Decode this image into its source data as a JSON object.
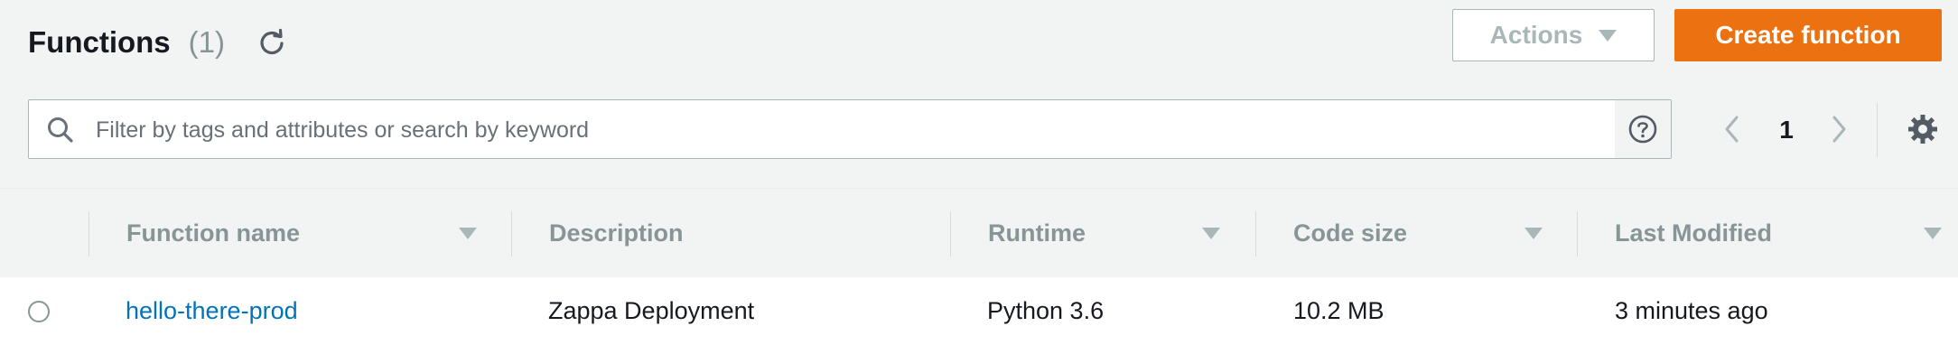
{
  "header": {
    "title": "Functions",
    "count": "(1)",
    "refresh_icon": "refresh-icon",
    "actions_label": "Actions",
    "create_label": "Create function"
  },
  "filter": {
    "placeholder": "Filter by tags and attributes or search by keyword",
    "value": ""
  },
  "pagination": {
    "current_page": "1"
  },
  "table": {
    "columns": [
      "Function name",
      "Description",
      "Runtime",
      "Code size",
      "Last Modified"
    ],
    "rows": [
      {
        "name": "hello-there-prod",
        "description": "Zappa Deployment",
        "runtime": "Python 3.6",
        "code_size": "10.2 MB",
        "last_modified": "3 minutes ago",
        "selected": false
      }
    ]
  },
  "colors": {
    "primary_button": "#ec7211",
    "link": "#0073bb",
    "page_background": "#f2f3f3",
    "muted_text": "#879596"
  }
}
